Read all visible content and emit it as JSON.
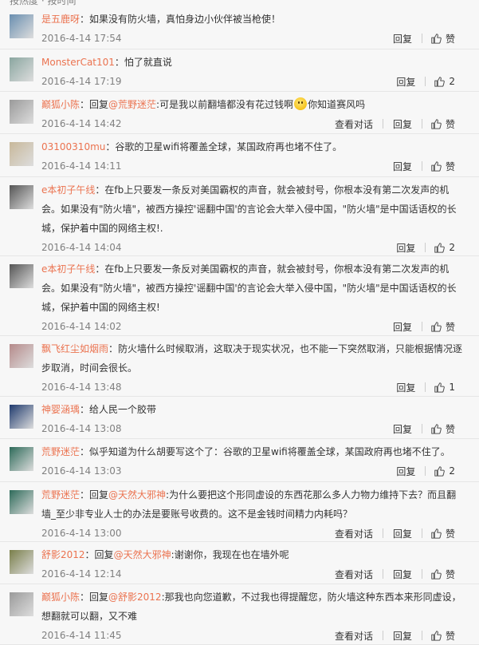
{
  "header_fragment": "按热度 · 按时间",
  "labels": {
    "reply": "回复",
    "view_conversation": "查看对话",
    "like": "赞"
  },
  "comments": [
    {
      "user": "是五鹿呀",
      "prefix": "",
      "mention": "",
      "text": "：如果没有防火墙，真怕身边小伙伴被当枪使！",
      "text2": "",
      "time": "2016-4-14 17:54",
      "likes": "赞",
      "has_view": false,
      "avatar_color": "#6a8fb0"
    },
    {
      "user": "MonsterCat101",
      "prefix": "",
      "mention": "",
      "text": "：怕了就直说",
      "text2": "",
      "time": "2016-4-14 17:19",
      "likes": "2",
      "has_view": false,
      "avatar_color": "#8aa6a0"
    },
    {
      "user": "巅狐小陈",
      "prefix": "：回复",
      "mention": "@荒野迷茫",
      "text": ":可是我以前翻墙都没有花过钱啊",
      "text2": "你知道赛风吗",
      "time": "2016-4-14 14:42",
      "likes": "赞",
      "has_view": true,
      "avatar_color": "#9a9a9a"
    },
    {
      "user": "03100310mu",
      "prefix": "",
      "mention": "",
      "text": "：谷歌的卫星wifi将覆盖全球，某国政府再也堵不住了。",
      "text2": "",
      "time": "2016-4-14 14:11",
      "likes": "赞",
      "has_view": false,
      "avatar_color": "#c8b89a"
    },
    {
      "user": "e本初子午线",
      "prefix": "",
      "mention": "",
      "text": "：在fb上只要发一条反对美国霸权的声音，就会被封号，你根本没有第二次发声的机会。如果没有\"防火墙\"，被西方操控'谣翻中国'的言论会大举入侵中国，\"防火墙\"是中国话语权的长城，保护着中国的网络主权!.",
      "text2": "",
      "time": "2016-4-14 14:04",
      "likes": "2",
      "has_view": false,
      "avatar_color": "#555"
    },
    {
      "user": "e本初子午线",
      "prefix": "",
      "mention": "",
      "text": "：在fb上只要发一条反对美国霸权的声音，就会被封号，你根本没有第二次发声的机会。如果没有\"防火墙\"，被西方操控'谣翻中国'的言论会大举入侵中国，\"防火墙\"是中国话语权的长城，保护着中国的网络主权!",
      "text2": "",
      "time": "2016-4-14 14:02",
      "likes": "赞",
      "has_view": false,
      "avatar_color": "#555"
    },
    {
      "user": "飘飞红尘如烟雨",
      "prefix": "",
      "mention": "",
      "text": "：防火墙什么时候取消，这取决于现实状况，也不能一下突然取消，只能根据情况逐步取消，时间会很长。",
      "text2": "",
      "time": "2016-4-14 13:48",
      "likes": "1",
      "has_view": false,
      "avatar_color": "#b58a8a"
    },
    {
      "user": "神婴涵瑀",
      "prefix": "",
      "mention": "",
      "text": "：给人民一个胶带",
      "text2": "",
      "time": "2016-4-14 13:08",
      "likes": "赞",
      "has_view": false,
      "avatar_color": "#1f3a6e"
    },
    {
      "user": "荒野迷茫",
      "prefix": "",
      "mention": "",
      "text": "：似乎知道为什么胡要写这个了：谷歌的卫星wifi将覆盖全球，某国政府再也堵不住了。",
      "text2": "",
      "time": "2016-4-14 13:03",
      "likes": "2",
      "has_view": false,
      "avatar_color": "#2e6b5a"
    },
    {
      "user": "荒野迷茫",
      "prefix": "：回复",
      "mention": "@天然大邪神",
      "text": ":为什么要把这个形同虚设的东西花那么多人力物力维持下去？而且翻墙_至少非专业人士的办法是要账号收费的。这不是金钱时间精力内耗吗？",
      "text2": "",
      "time": "2016-4-14 13:00",
      "likes": "赞",
      "has_view": true,
      "avatar_color": "#2e6b5a"
    },
    {
      "user": "舒影2012",
      "prefix": "：回复",
      "mention": "@天然大邪神",
      "text": ":谢谢你，我现在也在墙外呢",
      "text2": "",
      "time": "2016-4-14 12:14",
      "likes": "赞",
      "has_view": true,
      "avatar_color": "#7a7f4a"
    },
    {
      "user": "巅狐小陈",
      "prefix": "：回复",
      "mention": "@舒影2012",
      "text": ":那我也向您道歉，不过我也得提醒您，防火墙这种东西本来形同虚设，想翻就可以翻，又不难",
      "text2": "",
      "time": "2016-4-14 11:45",
      "likes": "赞",
      "has_view": true,
      "avatar_color": "#9a9a9a"
    }
  ]
}
